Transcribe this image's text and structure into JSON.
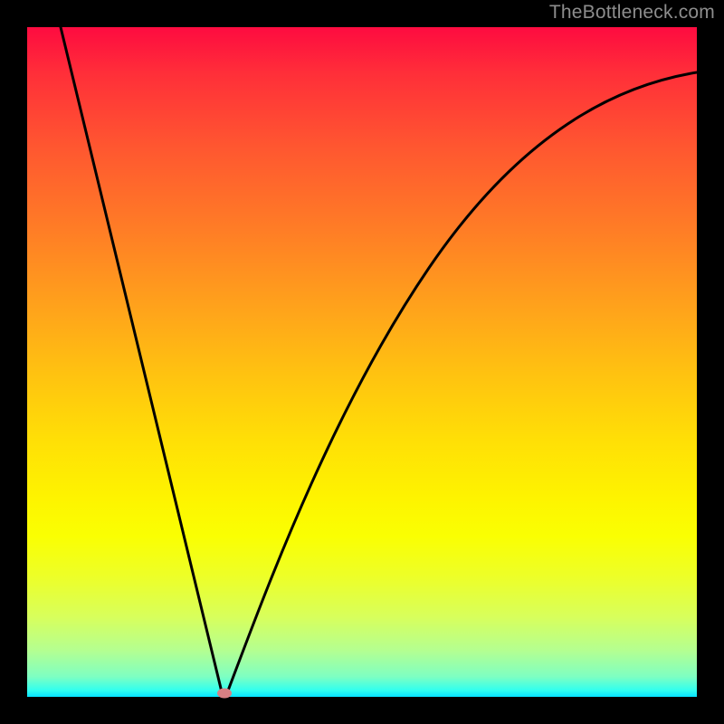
{
  "watermark": "TheBottleneck.com",
  "chart_data": {
    "type": "line",
    "title": "",
    "xlabel": "",
    "ylabel": "",
    "xlim": [
      0,
      100
    ],
    "ylim": [
      0,
      100
    ],
    "grid": false,
    "legend": false,
    "series": [
      {
        "name": "bottleneck-curve",
        "x": [
          5,
          10,
          15,
          20,
          25,
          29,
          30,
          31,
          35,
          40,
          45,
          50,
          55,
          60,
          65,
          70,
          75,
          80,
          85,
          90,
          95,
          100
        ],
        "y": [
          100,
          80,
          60,
          40,
          18,
          1,
          0,
          2,
          14,
          28,
          40,
          50,
          58,
          64,
          70,
          74,
          78,
          81,
          83.5,
          85.5,
          87,
          88
        ]
      }
    ],
    "marker": {
      "x": 29.5,
      "y": 0.5
    },
    "background": "rainbow-gradient-vertical",
    "colors": {
      "curve": "#000000",
      "marker": "#d98084",
      "frame": "#000000"
    }
  }
}
